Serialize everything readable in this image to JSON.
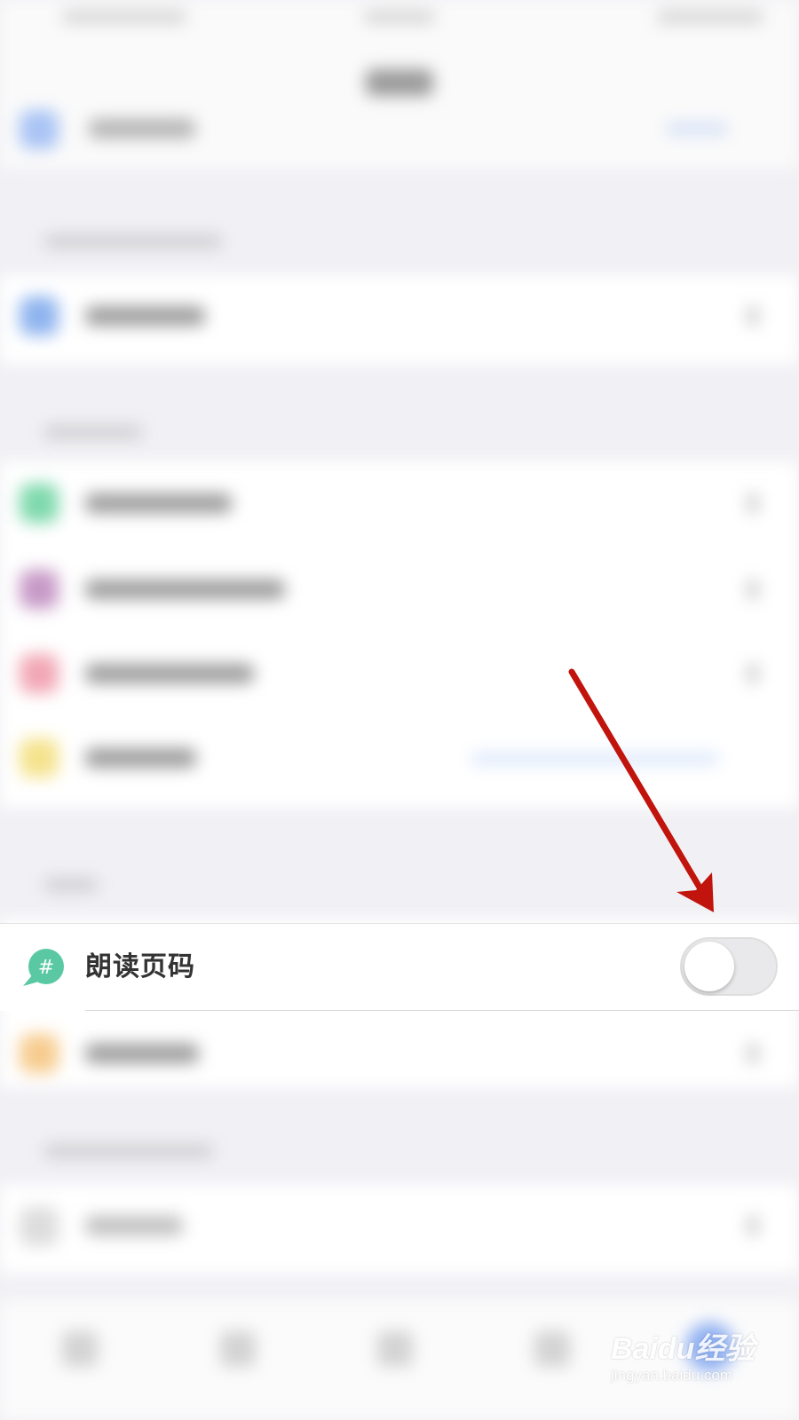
{
  "setting_row": {
    "label": "朗读页码",
    "icon": "hash-speech-bubble-icon",
    "icon_color": "#5ac9a3",
    "toggle_on": false
  },
  "annotation": {
    "arrow_color": "#c0140c"
  },
  "watermark": {
    "brand": "Baidu经验",
    "url": "jingyan.baidu.com"
  }
}
